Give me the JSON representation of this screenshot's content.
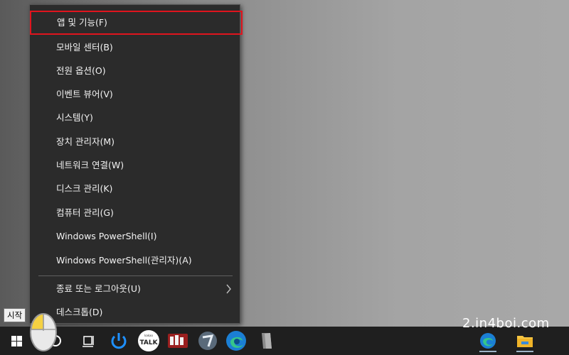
{
  "context_menu": {
    "items": [
      {
        "label": "앱 및 기능(F)",
        "highlighted": true
      },
      {
        "label": "모바일 센터(B)"
      },
      {
        "label": "전원 옵션(O)"
      },
      {
        "label": "이벤트 뷰어(V)"
      },
      {
        "label": "시스템(Y)"
      },
      {
        "label": "장치 관리자(M)"
      },
      {
        "label": "네트워크 연결(W)"
      },
      {
        "label": "디스크 관리(K)"
      },
      {
        "label": "컴퓨터 관리(G)"
      },
      {
        "label": "Windows PowerShell(I)"
      },
      {
        "label": "Windows PowerShell(관리자)(A)"
      },
      {
        "label": "종료 또는 로그아웃(U)",
        "submenu_icon": "chevron-right-icon"
      },
      {
        "label": "데스크톱(D)"
      }
    ],
    "highlight_color": "#e0141e"
  },
  "tooltip": {
    "text": "시작"
  },
  "taskbar": {
    "talk_label": "TALK",
    "kakao_label": "kakao",
    "icons": [
      "windows-start-icon",
      "search-icon",
      "task-view-icon",
      "power-app-icon",
      "kakaotalk-icon",
      "music-player-icon",
      "browser-icon",
      "edge-icon",
      "file-icon",
      "edge-pinned-icon",
      "file-explorer-icon"
    ]
  },
  "watermark": {
    "text": "2.in4boi.com"
  }
}
